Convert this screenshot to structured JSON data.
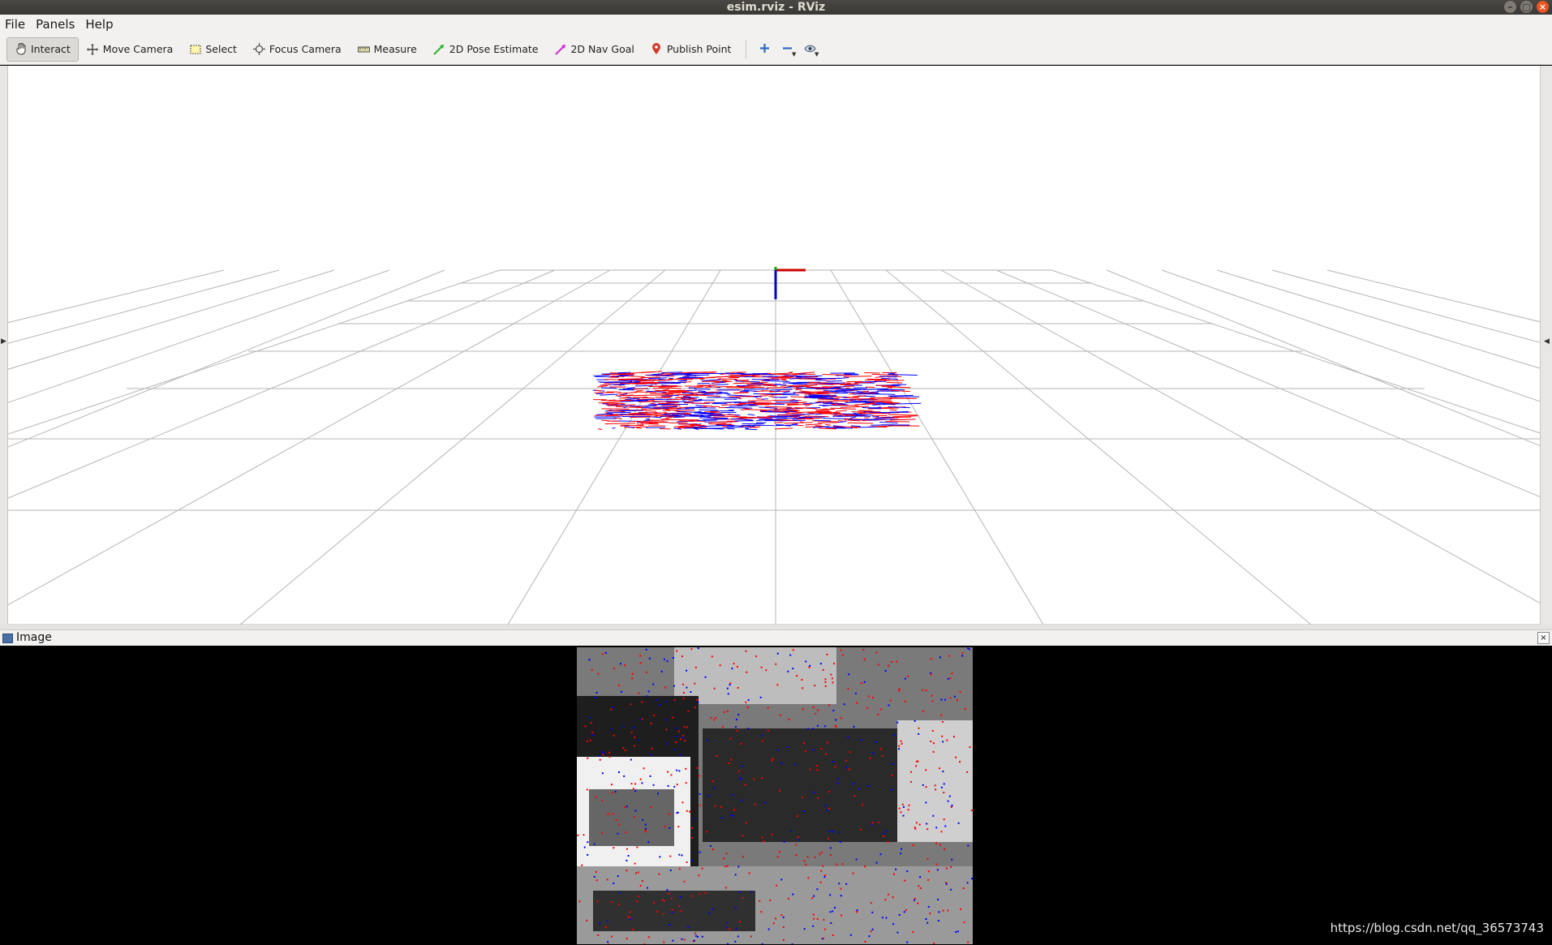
{
  "window": {
    "title": "esim.rviz - RViz"
  },
  "menu": [
    {
      "label": "File"
    },
    {
      "label": "Panels"
    },
    {
      "label": "Help"
    }
  ],
  "toolbar": {
    "tools": [
      {
        "label": "Interact",
        "icon": "hand-icon",
        "active": true
      },
      {
        "label": "Move Camera",
        "icon": "move-camera-icon",
        "active": false
      },
      {
        "label": "Select",
        "icon": "select-icon",
        "active": false
      },
      {
        "label": "Focus Camera",
        "icon": "focus-camera-icon",
        "active": false
      },
      {
        "label": "Measure",
        "icon": "ruler-icon",
        "active": false
      },
      {
        "label": "2D Pose Estimate",
        "icon": "pose-arrow-icon",
        "active": false
      },
      {
        "label": "2D Nav Goal",
        "icon": "nav-arrow-icon",
        "active": false
      },
      {
        "label": "Publish Point",
        "icon": "pin-icon",
        "active": false
      }
    ],
    "extra_icons": [
      "plus-icon",
      "minus-icon",
      "eye-icon"
    ]
  },
  "image_panel": {
    "title": "Image"
  },
  "watermark": "https://blog.csdn.net/qq_36573743",
  "colors": {
    "events_positive": "#ff0000",
    "events_negative": "#0000ff",
    "axis_x": "#cc0000",
    "axis_y": "#00aa00",
    "axis_z": "#0000cc",
    "grid": "#b5b5b5"
  }
}
